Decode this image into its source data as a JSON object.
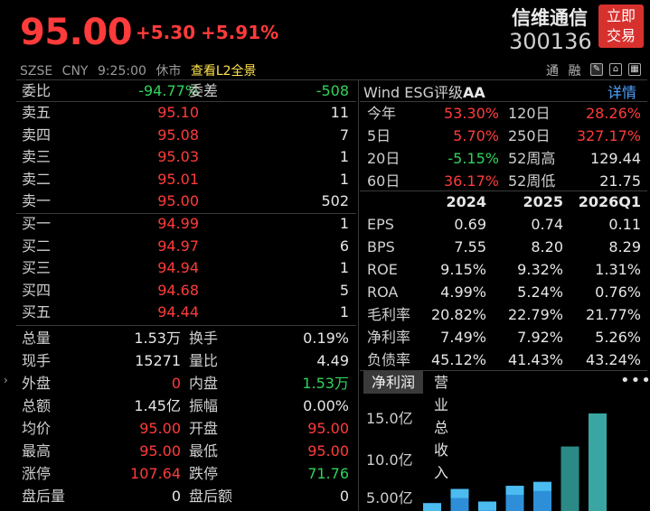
{
  "header": {
    "price": "95.00",
    "change": "+5.30",
    "change_pct": "+5.91%",
    "stock_name": "信维通信",
    "stock_code": "300136",
    "trade_button": [
      "立即",
      "交易"
    ]
  },
  "subbar": {
    "exchange": "SZSE",
    "currency": "CNY",
    "time": "9:25:00",
    "status": "休市",
    "l2_link": "查看L2全景",
    "tong": "通",
    "rong": "融"
  },
  "ratio": {
    "weibi_label": "委比",
    "weibi_value": "-94.77%",
    "weicha_label": "委差",
    "weicha_value": "-508"
  },
  "sell_orders": [
    {
      "label": "卖五",
      "price": "95.10",
      "volume": "11"
    },
    {
      "label": "卖四",
      "price": "95.08",
      "volume": "7"
    },
    {
      "label": "卖三",
      "price": "95.03",
      "volume": "1"
    },
    {
      "label": "卖二",
      "price": "95.01",
      "volume": "1"
    },
    {
      "label": "卖一",
      "price": "95.00",
      "volume": "502"
    }
  ],
  "buy_orders": [
    {
      "label": "买一",
      "price": "94.99",
      "volume": "1"
    },
    {
      "label": "买二",
      "price": "94.97",
      "volume": "6"
    },
    {
      "label": "买三",
      "price": "94.94",
      "volume": "1"
    },
    {
      "label": "买四",
      "price": "94.68",
      "volume": "5"
    },
    {
      "label": "买五",
      "price": "94.44",
      "volume": "1"
    }
  ],
  "quote": [
    {
      "l1": "总量",
      "v1": "1.53万",
      "c1": "white",
      "l2": "换手",
      "v2": "0.19%",
      "c2": "white"
    },
    {
      "l1": "现手",
      "v1": "15271",
      "c1": "white",
      "l2": "量比",
      "v2": "4.49",
      "c2": "white"
    },
    {
      "l1": "外盘",
      "v1": "0",
      "c1": "red",
      "l2": "内盘",
      "v2": "1.53万",
      "c2": "green"
    },
    {
      "l1": "总额",
      "v1": "1.45亿",
      "c1": "white",
      "l2": "振幅",
      "v2": "0.00%",
      "c2": "white"
    },
    {
      "l1": "均价",
      "v1": "95.00",
      "c1": "red",
      "l2": "开盘",
      "v2": "95.00",
      "c2": "red"
    },
    {
      "l1": "最高",
      "v1": "95.00",
      "c1": "red",
      "l2": "最低",
      "v2": "95.00",
      "c2": "red"
    },
    {
      "l1": "涨停",
      "v1": "107.64",
      "c1": "red",
      "l2": "跌停",
      "v2": "71.76",
      "c2": "green"
    },
    {
      "l1": "盘后量",
      "v1": "0",
      "c1": "white",
      "l2": "盘后额",
      "v2": "0",
      "c2": "white"
    }
  ],
  "esg": {
    "title": "Wind ESG评级",
    "rating": "AA",
    "detail_link": "详情"
  },
  "performance": [
    {
      "l1": "今年",
      "v1": "53.30%",
      "c1": "red",
      "l2": "120日",
      "v2": "28.26%",
      "c2": "red"
    },
    {
      "l1": "5日",
      "v1": "5.70%",
      "c1": "red",
      "l2": "250日",
      "v2": "327.17%",
      "c2": "red"
    },
    {
      "l1": "20日",
      "v1": "-5.15%",
      "c1": "green",
      "l2": "52周高",
      "v2": "129.44",
      "c2": "white"
    },
    {
      "l1": "60日",
      "v1": "36.17%",
      "c1": "red",
      "l2": "52周低",
      "v2": "21.75",
      "c2": "white"
    }
  ],
  "fin_headers": [
    "2024",
    "2025",
    "2026Q1"
  ],
  "financials": [
    {
      "label": "EPS",
      "values": [
        "0.69",
        "0.74",
        "0.11"
      ]
    },
    {
      "label": "BPS",
      "values": [
        "7.55",
        "8.20",
        "8.29"
      ]
    },
    {
      "label": "ROE",
      "values": [
        "9.15%",
        "9.32%",
        "1.31%"
      ]
    },
    {
      "label": "ROA",
      "values": [
        "4.99%",
        "5.24%",
        "0.76%"
      ]
    },
    {
      "label": "毛利率",
      "values": [
        "20.82%",
        "22.79%",
        "21.77%"
      ]
    },
    {
      "label": "净利率",
      "values": [
        "7.49%",
        "7.92%",
        "5.26%"
      ]
    },
    {
      "label": "负债率",
      "values": [
        "45.12%",
        "41.43%",
        "43.24%"
      ]
    }
  ],
  "tabs": {
    "active": "净利润",
    "other": "营业总收入",
    "more": "•••"
  },
  "chart_data": {
    "type": "bar",
    "yticks": [
      "15.0亿",
      "10.0亿",
      "5.00亿"
    ],
    "ytick_values": [
      15.0,
      10.0,
      5.0
    ],
    "ylim": [
      2.0,
      16.0
    ],
    "groups": [
      {
        "values": [
          3.0,
          2.0
        ],
        "colors": [
          "#2e8fd8",
          "#4cbcf0"
        ]
      },
      {
        "values": [
          4.8,
          3.0
        ],
        "colors": [
          "#2e8fd8",
          "#4cbcf0"
        ]
      },
      {
        "values": [
          3.2,
          1.0
        ],
        "colors": [
          "#2e8fd8",
          "#4cbcf0"
        ]
      },
      {
        "values": [
          5.2,
          3.0
        ],
        "colors": [
          "#2e8fd8",
          "#4cbcf0"
        ]
      },
      {
        "values": [
          5.7,
          3.0
        ],
        "colors": [
          "#2e8fd8",
          "#4cbcf0"
        ]
      },
      {
        "values": [
          10.2,
          0
        ],
        "colors": [
          "#2c8a86",
          "#2c8a86"
        ]
      },
      {
        "values": [
          14.4,
          0
        ],
        "colors": [
          "#3aa6a4",
          "#3aa6a4"
        ]
      }
    ],
    "grid": false
  }
}
